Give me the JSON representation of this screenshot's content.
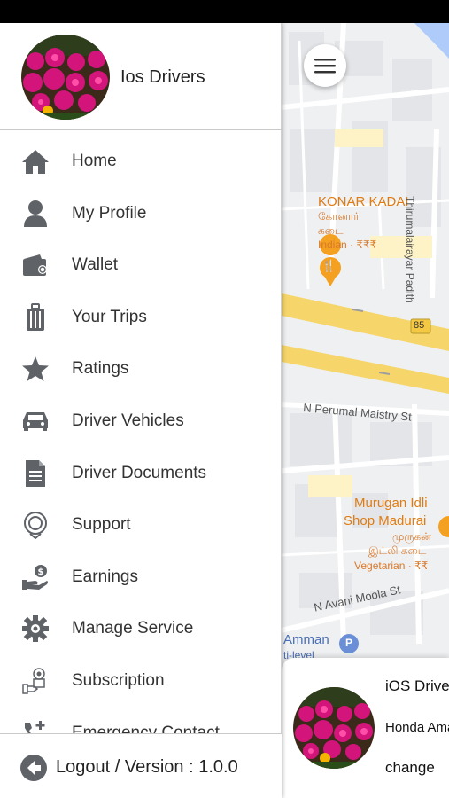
{
  "drawer": {
    "user_name": "Ios Drivers",
    "menu_items": [
      {
        "label": "Home",
        "icon": "home-icon"
      },
      {
        "label": "My Profile",
        "icon": "person-icon"
      },
      {
        "label": "Wallet",
        "icon": "wallet-icon"
      },
      {
        "label": "Your Trips",
        "icon": "luggage-icon"
      },
      {
        "label": "Ratings",
        "icon": "star-icon"
      },
      {
        "label": "Driver Vehicles",
        "icon": "car-icon"
      },
      {
        "label": "Driver Documents",
        "icon": "document-icon"
      },
      {
        "label": "Support",
        "icon": "support-icon"
      },
      {
        "label": "Earnings",
        "icon": "earnings-icon"
      },
      {
        "label": "Manage Service",
        "icon": "gear-icon"
      },
      {
        "label": "Subscription",
        "icon": "subscription-icon"
      },
      {
        "label": "Emergency Contact",
        "icon": "emergency-contact-icon"
      }
    ],
    "logout_label": "Logout / Version : 1.0.0"
  },
  "map": {
    "poi_konar_name": "KONAR KADAI",
    "poi_konar_tamil_1": "கோனார்",
    "poi_konar_tamil_2": "கடை",
    "poi_konar_detail": "Indian · ₹₹₹",
    "poi_murugan_name_1": "Murugan Idli",
    "poi_murugan_name_2": "Shop Madurai",
    "poi_murugan_tamil_1": "முருகன்",
    "poi_murugan_tamil_2": "இட்லி கடை",
    "poi_murugan_detail": "Vegetarian · ₹₹",
    "street_perumal": "N Perumal Maistry St",
    "street_avani": "N Avani Moola St",
    "street_thirumalai": "Thirumalairayar Padith",
    "road_shield": "85",
    "poi_amman": "Amman",
    "poi_amman_2": "ti-level",
    "parking": "P"
  },
  "driver_card": {
    "name": "iOS Drivers",
    "vehicle": "Honda Amaze",
    "change_label": "change"
  },
  "colors": {
    "icon_gray": "#5f6368",
    "major_road": "#f6d66a",
    "poi_orange": "#e07b12"
  }
}
